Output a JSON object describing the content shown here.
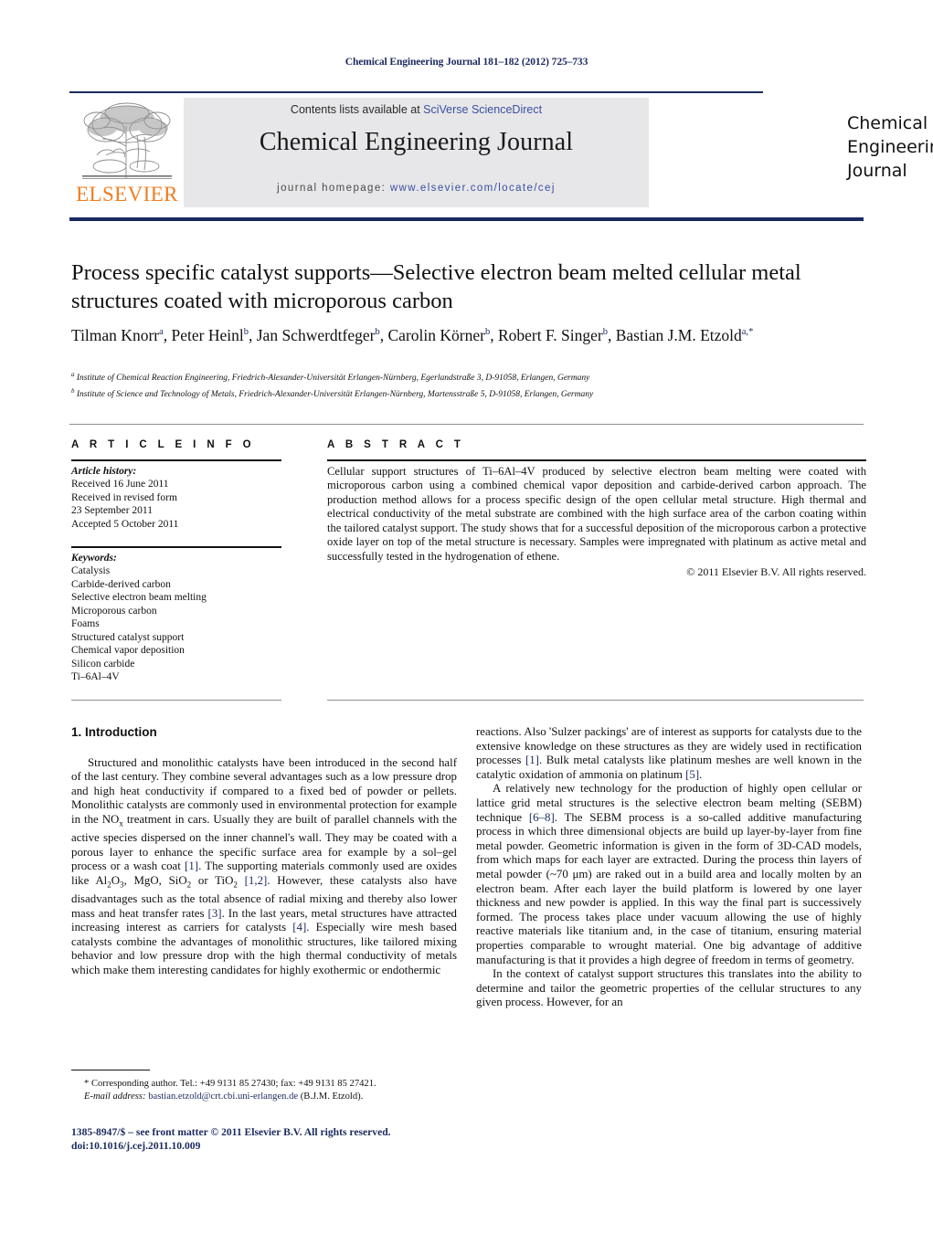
{
  "running_head": "Chemical Engineering Journal 181–182 (2012) 725–733",
  "masthead": {
    "contents_prefix": "Contents lists available at ",
    "contents_link": "SciVerse ScienceDirect",
    "journal_title": "Chemical Engineering Journal",
    "homepage_prefix": "journal homepage: ",
    "homepage_url": "www.elsevier.com/locate/cej",
    "publisher_wordmark": "ELSEVIER",
    "cover_title_line1": "Chemical",
    "cover_title_line2": "Engineering",
    "cover_title_line3": "Journal"
  },
  "article": {
    "title": "Process specific catalyst supports—Selective electron beam melted cellular metal structures coated with microporous carbon",
    "authors_html": "Tilman Knorr<sup>a</sup>, Peter Heinl<sup>b</sup>, Jan Schwerdtfeger<sup>b</sup>, Carolin Körner<sup>b</sup>, Robert F. Singer<sup>b</sup>, Bastian J.M. Etzold<sup>a,<span class=\"ast\">*</span></sup>",
    "affiliation_a": "Institute of Chemical Reaction Engineering, Friedrich-Alexander-Universität Erlangen-Nürnberg, Egerlandstraße 3, D-91058, Erlangen, Germany",
    "affiliation_b": "Institute of Science and Technology of Metals, Friedrich-Alexander-Universität Erlangen-Nürnberg, Martensstraße 5, D-91058, Erlangen, Germany"
  },
  "info": {
    "heading": "A R T I C L E    I N F O",
    "history_label": "Article history:",
    "history_lines": [
      "Received 16 June 2011",
      "Received in revised form",
      "23 September 2011",
      "Accepted 5 October 2011"
    ],
    "keywords_label": "Keywords:",
    "keywords": [
      "Catalysis",
      "Carbide-derived carbon",
      "Selective electron beam melting",
      "Microporous carbon",
      "Foams",
      "Structured catalyst support",
      "Chemical vapor deposition",
      "Silicon carbide",
      "Ti–6Al–4V"
    ]
  },
  "abstract": {
    "heading": "A B S T R A C T",
    "text": "Cellular support structures of Ti–6Al–4V produced by selective electron beam melting were coated with microporous carbon using a combined chemical vapor deposition and carbide-derived carbon approach. The production method allows for a process specific design of the open cellular metal structure. High thermal and electrical conductivity of the metal substrate are combined with the high surface area of the carbon coating within the tailored catalyst support. The study shows that for a successful deposition of the microporous carbon a protective oxide layer on top of the metal structure is necessary. Samples were impregnated with platinum as active metal and successfully tested in the hydrogenation of ethene.",
    "copyright": "© 2011 Elsevier B.V. All rights reserved."
  },
  "body": {
    "section_number_title": "1.  Introduction",
    "left_paragraphs": [
      "Structured and monolithic catalysts have been introduced in the second half of the last century. They combine several advantages such as a low pressure drop and high heat conductivity if compared to a fixed bed of powder or pellets. Monolithic catalysts are commonly used in environmental protection for example in the NO<sub>x</sub> treatment in cars. Usually they are built of parallel channels with the active species dispersed on the inner channel's wall. They may be coated with a porous layer to enhance the specific surface area for example by a sol–gel process or a wash coat <span class=\"ref\">[1]</span>. The supporting materials commonly used are oxides like Al<sub>2</sub>O<sub>3</sub>, MgO, SiO<sub>2</sub> or TiO<sub>2</sub> <span class=\"ref\">[1,2]</span>. However, these catalysts also have disadvantages such as the total absence of radial mixing and thereby also lower mass and heat transfer rates <span class=\"ref\">[3]</span>. In the last years, metal structures have attracted increasing interest as carriers for catalysts <span class=\"ref\">[4]</span>. Especially wire mesh based catalysts combine the advantages of monolithic structures, like tailored mixing behavior and low pressure drop with the high thermal conductivity of metals which make them interesting candidates for highly exothermic or endothermic"
    ],
    "right_paragraphs": [
      {
        "indent": false,
        "html": "reactions. Also 'Sulzer packings' are of interest as supports for catalysts due to the extensive knowledge on these structures as they are widely used in rectification processes <span class=\"ref\">[1]</span>. Bulk metal catalysts like platinum meshes are well known in the catalytic oxidation of ammonia on platinum <span class=\"ref\">[5]</span>."
      },
      {
        "indent": true,
        "html": "A relatively new technology for the production of highly open cellular or lattice grid metal structures is the selective electron beam melting (SEBM) technique <span class=\"ref\">[6–8]</span>. The SEBM process is a so-called additive manufacturing process in which three dimensional objects are build up layer-by-layer from fine metal powder. Geometric information is given in the form of 3D-CAD models, from which maps for each layer are extracted. During the process thin layers of metal powder (~70 μm) are raked out in a build area and locally molten by an electron beam. After each layer the build platform is lowered by one layer thickness and new powder is applied. In this way the final part is successively formed. The process takes place under vacuum allowing the use of highly reactive materials like titanium and, in the case of titanium, ensuring material properties comparable to wrought material. One big advantage of additive manufacturing is that it provides a high degree of freedom in terms of geometry."
      },
      {
        "indent": true,
        "html": "In the context of catalyst support structures this translates into the ability to determine and tailor the geometric properties of the cellular structures to any given process. However, for an"
      }
    ]
  },
  "footnote": {
    "corresponding": "* Corresponding author. Tel.: +49 9131 85 27430; fax: +49 9131 85 27421.",
    "email_label": "E-mail address:",
    "email": "bastian.etzold@crt.cbi.uni-erlangen.de",
    "email_owner": "(B.J.M. Etzold)."
  },
  "issn_line1": "1385-8947/$ – see front matter © 2011 Elsevier B.V. All rights reserved.",
  "issn_line2": "doi:10.1016/j.cej.2011.10.009",
  "colors": {
    "navy": "#1b2a5e",
    "link_blue": "#3a4fa0",
    "elsevier_orange": "#f07d20",
    "panel_grey": "#e7e7e9"
  }
}
